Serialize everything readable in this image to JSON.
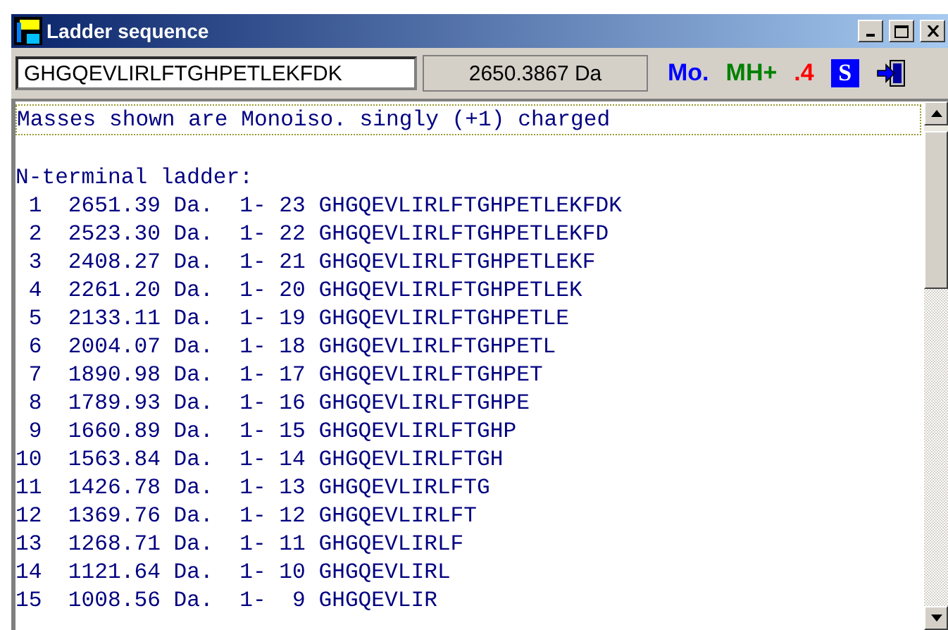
{
  "window": {
    "title": "Ladder sequence"
  },
  "toolbar": {
    "sequence": "GHGQEVLIRLFTGHPETLEKFDK",
    "mass": "2650.3867 Da",
    "mass_type": "Mo.",
    "charge_mode": "MH+",
    "decimals": ".4",
    "s_button": "S"
  },
  "listing": {
    "note": "Masses shown are Monoiso. singly (+1) charged",
    "heading": "N-terminal ladder:",
    "rows": [
      " 1  2651.39 Da.  1- 23 GHGQEVLIRLFTGHPETLEKFDK",
      " 2  2523.30 Da.  1- 22 GHGQEVLIRLFTGHPETLEKFD",
      " 3  2408.27 Da.  1- 21 GHGQEVLIRLFTGHPETLEKF",
      " 4  2261.20 Da.  1- 20 GHGQEVLIRLFTGHPETLEK",
      " 5  2133.11 Da.  1- 19 GHGQEVLIRLFTGHPETLE",
      " 6  2004.07 Da.  1- 18 GHGQEVLIRLFTGHPETL",
      " 7  1890.98 Da.  1- 17 GHGQEVLIRLFTGHPET",
      " 8  1789.93 Da.  1- 16 GHGQEVLIRLFTGHPE",
      " 9  1660.89 Da.  1- 15 GHGQEVLIRLFTGHP",
      "10  1563.84 Da.  1- 14 GHGQEVLIRLFTGH",
      "11  1426.78 Da.  1- 13 GHGQEVLIRLFTG",
      "12  1369.76 Da.  1- 12 GHGQEVLIRLFT",
      "13  1268.71 Da.  1- 11 GHGQEVLIRLF",
      "14  1121.64 Da.  1- 10 GHGQEVLIRL",
      "15  1008.56 Da.  1-  9 GHGQEVLIR"
    ]
  }
}
